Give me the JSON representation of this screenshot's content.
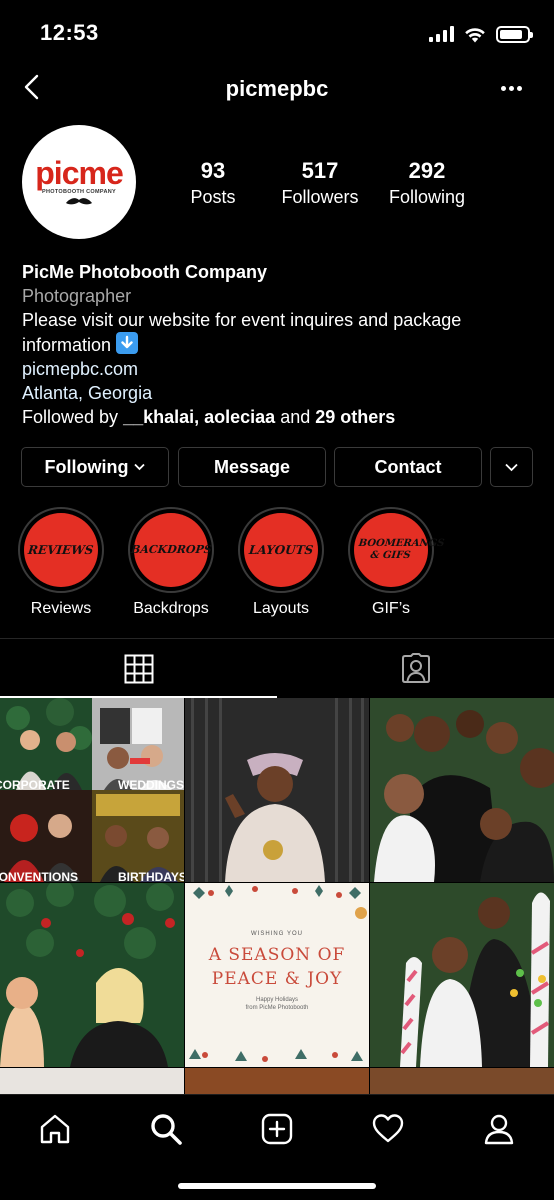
{
  "status_bar": {
    "time": "12:53",
    "battery_level": 0.85
  },
  "nav": {
    "title": "picmepbc"
  },
  "profile": {
    "logo_text": "picme",
    "logo_sub": "PHOTOBOOTH COMPANY",
    "stats": {
      "posts": {
        "value": "93",
        "label": "Posts"
      },
      "followers": {
        "value": "517",
        "label": "Followers"
      },
      "following": {
        "value": "292",
        "label": "Following"
      }
    },
    "name": "PicMe Photobooth Company",
    "category": "Photographer",
    "bio_line1": "Please visit our website for event inquires and package",
    "bio_line2": "information",
    "website": "picmepbc.com",
    "location": "Atlanta, Georgia",
    "followed_by_prefix": "Followed by ",
    "followed_by_user1": "__khalai",
    "followed_by_sep": ", ",
    "followed_by_user2": "aoleciaa",
    "followed_by_and": " and ",
    "followed_by_others": "29 others"
  },
  "actions": {
    "following_label": "Following",
    "message_label": "Message",
    "contact_label": "Contact"
  },
  "highlights": [
    {
      "cover_text": "REVIEWS",
      "label": "Reviews"
    },
    {
      "cover_text": "BACKDROPS",
      "label": "Backdrops"
    },
    {
      "cover_text": "LAYOUTS",
      "label": "Layouts"
    },
    {
      "cover_text": "BOOMERANGS & GIFS",
      "label": "GIF’s"
    }
  ],
  "posts": {
    "tile1": {
      "tl": "",
      "tr": "",
      "label_corporate": "CORPORATE",
      "label_weddings": "WEDDINGS",
      "label_conventions": "CONVENTIONS",
      "label_birthdays": "BIRTHDAYS"
    },
    "card": {
      "wishing": "WISHING YOU",
      "line1": "A SEASON OF",
      "line2": "PEACE & JOY",
      "small1": "Happy Holidays",
      "small2": "from PicMe Photobooth"
    }
  },
  "colors": {
    "background": "#000000",
    "highlight_red": "#e42f24",
    "brand_red": "#d7261b",
    "muted_text": "#a8a8a8",
    "card_red": "#c94a3a"
  },
  "icons": {
    "back": "chevron-left-icon",
    "more": "more-horizontal-icon",
    "grid": "grid-icon",
    "tagged": "tagged-user-icon",
    "home": "home-icon",
    "search": "search-icon",
    "new_post": "add-post-icon",
    "activity": "heart-icon",
    "profile": "profile-icon"
  }
}
